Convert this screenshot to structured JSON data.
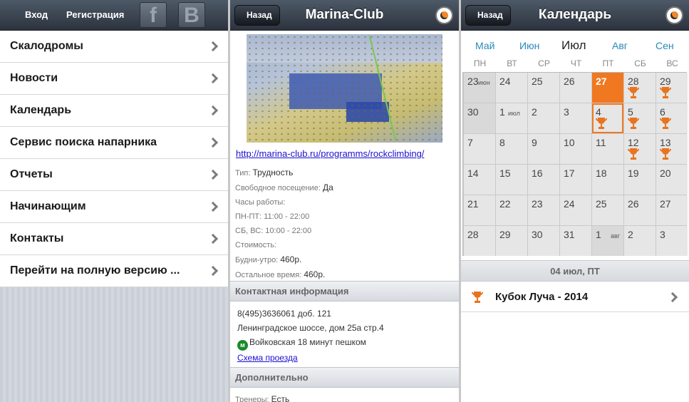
{
  "left": {
    "login": "Вход",
    "register": "Регистрация",
    "fb": "f",
    "vk": "B",
    "menu": [
      "Скалодромы",
      "Новости",
      "Календарь",
      "Сервис поиска напарника",
      "Отчеты",
      "Начинающим",
      "Контакты",
      "Перейти на полную версию ..."
    ]
  },
  "club": {
    "back": "Назад",
    "title": "Marina-Club",
    "url": "http://marina-club.ru/programms/rockclimbing/",
    "type_label": "Тип:",
    "type_value": "Трудность",
    "free_label": "Свободное посещение:",
    "free_value": "Да",
    "hours_label": "Часы работы:",
    "weekdays": "ПН-ПТ: 11:00 - 22:00",
    "weekend": "СБ, ВС: 10:00 - 22:00",
    "cost_label": "Стоимость:",
    "morning_label": "Будни-утро:",
    "morning_value": "460р.",
    "other_label": "Остальное время:",
    "other_value": "460р.",
    "contacts_header": "Контактная информация",
    "phone": "8(495)3636061 доб. 121",
    "address": "Ленинградское шоссе, дом 25а стр.4",
    "metro_icon": "м",
    "metro": "Войковская 18 минут пешком",
    "map_link": "Схема проезда",
    "extra_header": "Дополнительно",
    "trainers_label": "Тренеры:",
    "trainers_value": "Есть"
  },
  "calendar": {
    "back": "Назад",
    "title": "Календарь",
    "months": [
      "Май",
      "Июн",
      "Июл",
      "Авг",
      "Сен"
    ],
    "weekdays": [
      "ПН",
      "ВТ",
      "СР",
      "ЧТ",
      "ПТ",
      "СБ",
      "ВС"
    ],
    "days": [
      [
        "23",
        "24",
        "25",
        "26",
        "27",
        "28",
        "29"
      ],
      [
        "30",
        "1",
        "2",
        "3",
        "4",
        "5",
        "6"
      ],
      [
        "7",
        "8",
        "9",
        "10",
        "11",
        "12",
        "13"
      ],
      [
        "14",
        "15",
        "16",
        "17",
        "18",
        "19",
        "20"
      ],
      [
        "21",
        "22",
        "23",
        "24",
        "25",
        "26",
        "27"
      ],
      [
        "28",
        "29",
        "30",
        "31",
        "1",
        "2",
        "3"
      ]
    ],
    "month_tags": {
      "jun": "июн",
      "jul": "июл",
      "aug": "авг"
    },
    "selected_date": "04 июл, ПТ",
    "event": "Кубок Луча - 2014"
  }
}
